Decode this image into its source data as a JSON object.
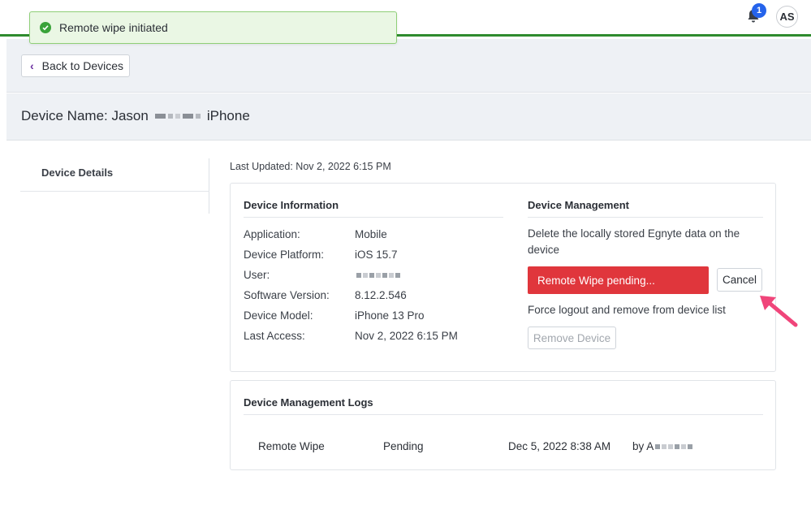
{
  "header": {
    "notification_count": "1",
    "avatar_initials": "AS",
    "accent_color": "#2e8b2e"
  },
  "toast": {
    "message": "Remote wipe initiated",
    "icon": "check-circle-icon"
  },
  "nav": {
    "back_label": "Back to Devices"
  },
  "device": {
    "title_prefix": "Device Name: Jason",
    "title_suffix": "iPhone"
  },
  "sidebar": {
    "items": [
      {
        "label": "Device Details"
      }
    ]
  },
  "last_updated": "Last Updated: Nov 2, 2022 6:15 PM",
  "device_information": {
    "title": "Device Information",
    "rows": [
      {
        "label": "Application:",
        "value": "Mobile"
      },
      {
        "label": "Device Platform:",
        "value": "iOS 15.7"
      },
      {
        "label": "User:",
        "value": ""
      },
      {
        "label": "Software Version:",
        "value": "8.12.2.546"
      },
      {
        "label": "Device Model:",
        "value": "iPhone 13 Pro"
      },
      {
        "label": "Last Access:",
        "value": "Nov 2, 2022 6:15 PM"
      }
    ]
  },
  "device_management": {
    "title": "Device Management",
    "wipe_description": "Delete the locally stored Egnyte data on the device",
    "wipe_button": "Remote Wipe pending...",
    "cancel_button": "Cancel",
    "remove_description": "Force logout and remove from device list",
    "remove_button": "Remove Device",
    "danger_color": "#e0363c"
  },
  "logs": {
    "title": "Device Management Logs",
    "rows": [
      {
        "action": "Remote Wipe",
        "status": "Pending",
        "date": "Dec 5, 2022 8:38 AM",
        "by": "by A"
      }
    ]
  }
}
